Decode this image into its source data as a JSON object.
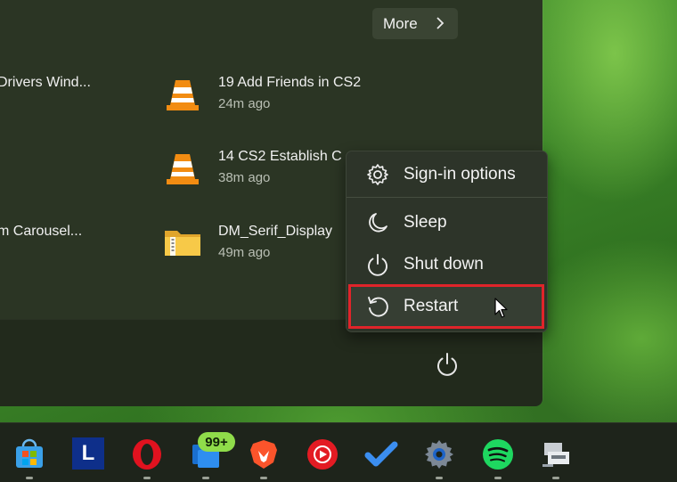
{
  "start_menu": {
    "more_label": "More",
    "recommended": [
      {
        "title": "Drivers Wind...",
        "time": ""
      },
      {
        "title": "19 Add Friends in CS2",
        "time": "24m ago",
        "icon": "vlc-icon"
      },
      {
        "title": "14 CS2 Establish C",
        "time": "38m ago",
        "icon": "vlc-icon"
      },
      {
        "title": "m Carousel...",
        "time": ""
      },
      {
        "title": "DM_Serif_Display",
        "time": "49m ago",
        "icon": "zip-folder-icon"
      }
    ]
  },
  "power_menu": {
    "items": [
      {
        "label": "Sign-in options",
        "icon": "gear-icon"
      },
      {
        "label": "Sleep",
        "icon": "moon-icon"
      },
      {
        "label": "Shut down",
        "icon": "power-icon"
      },
      {
        "label": "Restart",
        "icon": "restart-icon"
      }
    ],
    "highlight_color": "#e0242a"
  },
  "taskbar": {
    "badge_count": "99+",
    "apps": [
      {
        "name": "microsoft-store-icon"
      },
      {
        "name": "l-app-icon",
        "letter": "L"
      },
      {
        "name": "opera-icon"
      },
      {
        "name": "taskbar-app-badge-icon"
      },
      {
        "name": "brave-icon"
      },
      {
        "name": "youtube-music-icon"
      },
      {
        "name": "todo-icon"
      },
      {
        "name": "settings-icon"
      },
      {
        "name": "spotify-icon"
      },
      {
        "name": "network-drive-icon"
      }
    ]
  }
}
